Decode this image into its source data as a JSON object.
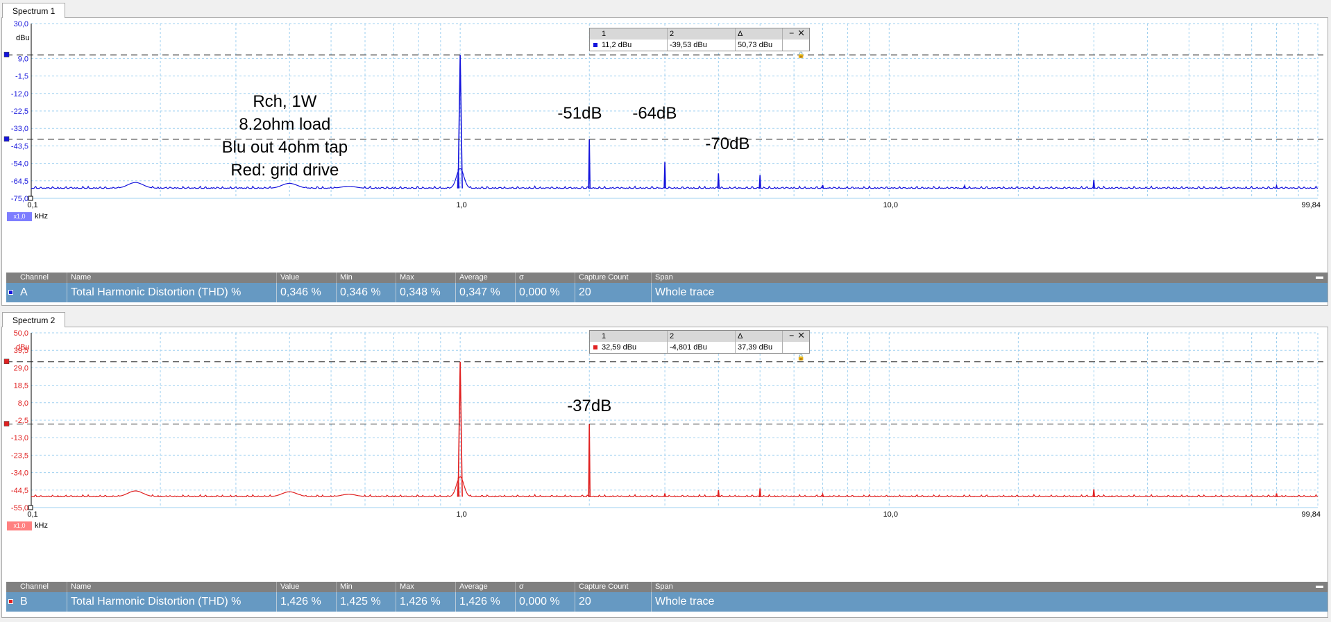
{
  "colors": {
    "blue": "#1414dc",
    "red": "#e02020",
    "grid": "#9fd0f0",
    "marker": "#222222"
  },
  "panels": [
    {
      "tab": "Spectrum 1",
      "unit": "dBu",
      "color": "#1414dc",
      "badge": "x1,0",
      "x_unit": "kHz",
      "cursor_box": {
        "headers": [
          "1",
          "2",
          "Δ"
        ],
        "values": [
          "11,2 dBu",
          "-39,53 dBu",
          "50,73 dBu"
        ]
      },
      "stats": {
        "headers": [
          "Channel",
          "Name",
          "Value",
          "Min",
          "Max",
          "Average",
          "σ",
          "Capture Count",
          "Span"
        ],
        "row": [
          "A",
          "Total Harmonic Distortion (THD) %",
          "0,346 %",
          "0,346 %",
          "0,348 %",
          "0,347 %",
          "0,000 %",
          "20",
          "Whole trace"
        ]
      }
    },
    {
      "tab": "Spectrum 2",
      "unit": "dBu",
      "color": "#e02020",
      "badge": "x1,0",
      "x_unit": "kHz",
      "cursor_box": {
        "headers": [
          "1",
          "2",
          "Δ"
        ],
        "values": [
          "32,59 dBu",
          "-4,801 dBu",
          "37,39 dBu"
        ]
      },
      "stats": {
        "headers": [
          "Channel",
          "Name",
          "Value",
          "Min",
          "Max",
          "Average",
          "σ",
          "Capture Count",
          "Span"
        ],
        "row": [
          "B",
          "Total Harmonic Distortion (THD) %",
          "1,426 %",
          "1,425 %",
          "1,426 %",
          "1,426 %",
          "0,000 %",
          "20",
          "Whole trace"
        ]
      }
    }
  ],
  "chart_data": [
    {
      "type": "line",
      "title": "Spectrum 1",
      "xscale": "log",
      "xlim": [
        0.1,
        99.84
      ],
      "ylim": [
        -75.0,
        30.0
      ],
      "ylabel": "dBu",
      "xlabel": "kHz",
      "yticks": [
        "30,0",
        "9,0",
        "-1,5",
        "-12,0",
        "-22,5",
        "-33,0",
        "-43,5",
        "-54,0",
        "-64,5",
        "-75,0"
      ],
      "xticks": [
        "0,1",
        "1,0",
        "10,0",
        "99,84"
      ],
      "grid": true,
      "noise_floor": -69.0,
      "bumps": [
        {
          "x": 0.175,
          "y": -65.5
        },
        {
          "x": 0.4,
          "y": -66.0
        },
        {
          "x": 0.55,
          "y": -67.8
        }
      ],
      "peaks": [
        {
          "x": 0.99,
          "y": -57.5
        },
        {
          "x": 1.0,
          "y": 11.2
        },
        {
          "x": 2.0,
          "y": -39.53
        },
        {
          "x": 3.0,
          "y": -53.2
        },
        {
          "x": 4.0,
          "y": -60.0
        },
        {
          "x": 5.0,
          "y": -61.0
        },
        {
          "x": 7.0,
          "y": -67.0
        },
        {
          "x": 15.0,
          "y": -67.5
        },
        {
          "x": 30.0,
          "y": -64.0
        },
        {
          "x": 80.0,
          "y": -67.5
        }
      ],
      "cursors": [
        11.2,
        -39.53
      ],
      "annotations": [
        {
          "lines": [
            "Rch, 1W",
            "8.2ohm load",
            "Blu out 4ohm tap",
            "Red: grid drive"
          ],
          "x": 0.39,
          "y": -20.0,
          "anchor": "middle"
        },
        {
          "lines": [
            "-51dB"
          ],
          "x": 1.9,
          "y": -27.0,
          "anchor": "middle"
        },
        {
          "lines": [
            "-64dB"
          ],
          "x": 2.84,
          "y": -27.0,
          "anchor": "middle"
        },
        {
          "lines": [
            "-70dB"
          ],
          "x": 4.2,
          "y": -45.5,
          "anchor": "middle"
        }
      ]
    },
    {
      "type": "line",
      "title": "Spectrum 2",
      "xscale": "log",
      "xlim": [
        0.1,
        99.84
      ],
      "ylim": [
        -55.0,
        50.0
      ],
      "ylabel": "dBu",
      "xlabel": "kHz",
      "yticks": [
        "50,0",
        "39,5",
        "29,0",
        "18,5",
        "8,0",
        "-2,5",
        "-13,0",
        "-23,5",
        "-34,0",
        "-44,5",
        "-55,0"
      ],
      "xticks": [
        "0,1",
        "1,0",
        "10,0",
        "99,84"
      ],
      "grid": true,
      "noise_floor": -48.5,
      "bumps": [
        {
          "x": 0.175,
          "y": -45.0
        },
        {
          "x": 0.4,
          "y": -45.5
        },
        {
          "x": 0.55,
          "y": -47.0
        }
      ],
      "peaks": [
        {
          "x": 0.99,
          "y": -37.0
        },
        {
          "x": 1.0,
          "y": 32.59
        },
        {
          "x": 2.0,
          "y": -4.801
        },
        {
          "x": 3.0,
          "y": -46.5
        },
        {
          "x": 4.0,
          "y": -44.5
        },
        {
          "x": 5.0,
          "y": -43.5
        },
        {
          "x": 7.0,
          "y": -47.0
        },
        {
          "x": 30.0,
          "y": -44.0
        },
        {
          "x": 80.0,
          "y": -46.5
        }
      ],
      "cursors": [
        32.59,
        -4.801
      ],
      "annotations": [
        {
          "lines": [
            "-37dB"
          ],
          "x": 2.0,
          "y": 3.0,
          "anchor": "middle"
        }
      ]
    }
  ]
}
